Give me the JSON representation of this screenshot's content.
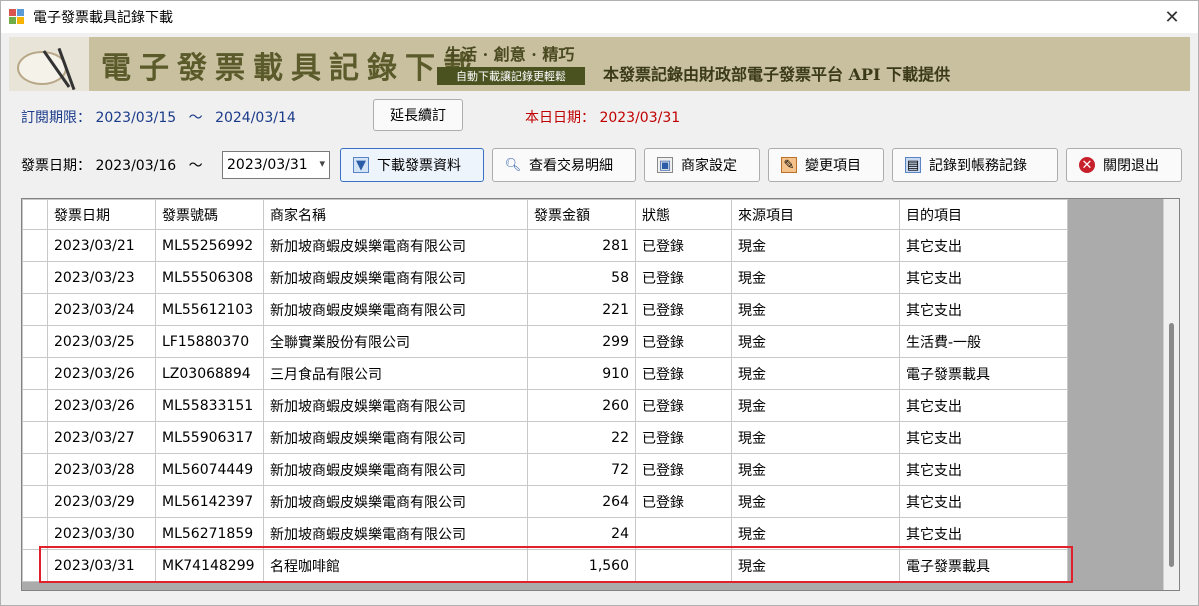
{
  "window": {
    "title": "電子發票載具記錄下載",
    "close_glyph": "✕"
  },
  "banner": {
    "title": "電子發票載具記錄下載",
    "slogan": "生活 · 創意 · 精巧",
    "subtitle": "自動下載讓記錄更輕鬆",
    "note": "本發票記錄由財政部電子發票平台 API 下載提供"
  },
  "subscription": {
    "label": "訂閱期限：",
    "start": "2023/03/15",
    "sep": "〜",
    "end": "2024/03/14",
    "extend_button": "延長續訂"
  },
  "today": {
    "label": "本日日期：",
    "value": "2023/03/31"
  },
  "invoice_date": {
    "label": "發票日期：",
    "start": "2023/03/16",
    "sep": "〜",
    "end_value": "2023/03/31"
  },
  "toolbar": {
    "download": "下載發票資料",
    "view_details": "查看交易明細",
    "merchant_settings": "商家設定",
    "change_items": "變更項目",
    "record_accounts": "記錄到帳務記錄",
    "close_exit": "關閉退出"
  },
  "icons": {
    "download": "download-icon",
    "search": "magnifier-icon",
    "store": "store-icon",
    "change": "edit-icon",
    "record": "ledger-icon",
    "close": "close-circle-icon"
  },
  "colors": {
    "subscription_text": "#1a3a8a",
    "today_text": "#c00000",
    "highlight_border": "#e0202a"
  },
  "table": {
    "columns": [
      "發票日期",
      "發票號碼",
      "商家名稱",
      "發票金額",
      "狀態",
      "來源項目",
      "目的項目"
    ],
    "rows": [
      [
        "2023/03/21",
        "ML55256992",
        "新加坡商蝦皮娛樂電商有限公司",
        "281",
        "已登錄",
        "現金",
        "其它支出"
      ],
      [
        "2023/03/23",
        "ML55506308",
        "新加坡商蝦皮娛樂電商有限公司",
        "58",
        "已登錄",
        "現金",
        "其它支出"
      ],
      [
        "2023/03/24",
        "ML55612103",
        "新加坡商蝦皮娛樂電商有限公司",
        "221",
        "已登錄",
        "現金",
        "其它支出"
      ],
      [
        "2023/03/25",
        "LF15880370",
        "全聯實業股份有限公司",
        "299",
        "已登錄",
        "現金",
        "生活費-一般"
      ],
      [
        "2023/03/26",
        "LZ03068894",
        "三月食品有限公司",
        "910",
        "已登錄",
        "現金",
        "電子發票載具"
      ],
      [
        "2023/03/26",
        "ML55833151",
        "新加坡商蝦皮娛樂電商有限公司",
        "260",
        "已登錄",
        "現金",
        "其它支出"
      ],
      [
        "2023/03/27",
        "ML55906317",
        "新加坡商蝦皮娛樂電商有限公司",
        "22",
        "已登錄",
        "現金",
        "其它支出"
      ],
      [
        "2023/03/28",
        "ML56074449",
        "新加坡商蝦皮娛樂電商有限公司",
        "72",
        "已登錄",
        "現金",
        "其它支出"
      ],
      [
        "2023/03/29",
        "ML56142397",
        "新加坡商蝦皮娛樂電商有限公司",
        "264",
        "已登錄",
        "現金",
        "其它支出"
      ],
      [
        "2023/03/30",
        "ML56271859",
        "新加坡商蝦皮娛樂電商有限公司",
        "24",
        "",
        "現金",
        "其它支出"
      ],
      [
        "2023/03/31",
        "MK74148299",
        "名程咖啡館",
        "1,560",
        "",
        "現金",
        "電子發票載具"
      ]
    ]
  }
}
